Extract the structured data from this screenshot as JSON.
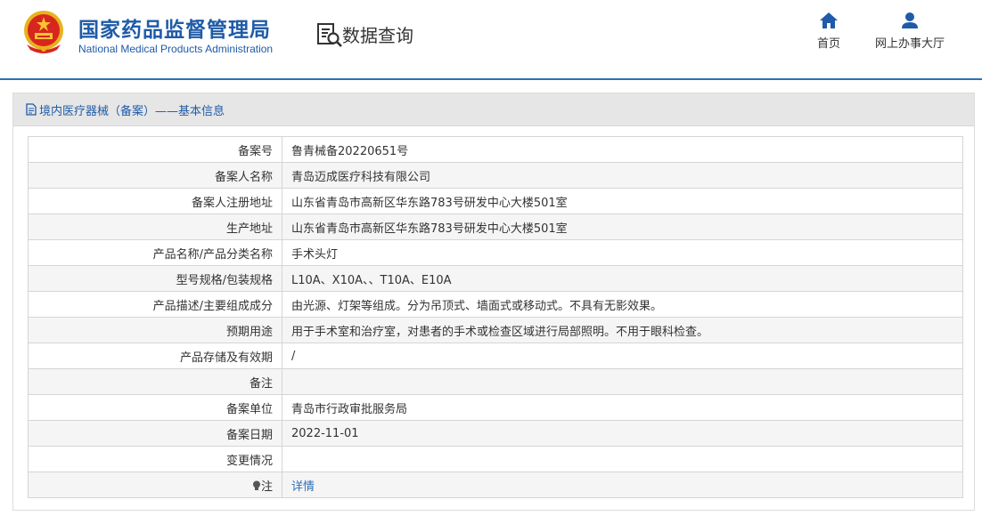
{
  "header": {
    "org_name_cn": "国家药品监督管理局",
    "org_name_en": "National Medical Products Administration",
    "query_title": "数据查询",
    "nav": {
      "home": "首页",
      "online_hall": "网上办事大厅"
    },
    "icons": {
      "emblem": "national-emblem-icon",
      "query": "document-search-icon",
      "home": "home-icon",
      "user": "user-icon"
    }
  },
  "panel": {
    "title": "境内医疗器械（备案）——基本信息",
    "rows": [
      {
        "label": "备案号",
        "value": "鲁青械备20220651号"
      },
      {
        "label": "备案人名称",
        "value": "青岛迈成医疗科技有限公司"
      },
      {
        "label": "备案人注册地址",
        "value": "山东省青岛市高新区华东路783号研发中心大楼501室"
      },
      {
        "label": "生产地址",
        "value": "山东省青岛市高新区华东路783号研发中心大楼501室"
      },
      {
        "label": "产品名称/产品分类名称",
        "value": "手术头灯"
      },
      {
        "label": "型号规格/包装规格",
        "value": "L10A、X10A、、T10A、E10A"
      },
      {
        "label": "产品描述/主要组成成分",
        "value": "由光源、灯架等组成。分为吊顶式、墙面式或移动式。不具有无影效果。"
      },
      {
        "label": "预期用途",
        "value": "用于手术室和治疗室，对患者的手术或检查区域进行局部照明。不用于眼科检查。"
      },
      {
        "label": "产品存储及有效期",
        "value": "/"
      },
      {
        "label": "备注",
        "value": ""
      },
      {
        "label": "备案单位",
        "value": "青岛市行政审批服务局"
      },
      {
        "label": "备案日期",
        "value": "2022-11-01"
      },
      {
        "label": "变更情况",
        "value": ""
      }
    ],
    "note_row": {
      "label": "注",
      "link": "详情"
    }
  },
  "colors": {
    "brand_blue": "#1f5ba8",
    "link_blue": "#2f6fb5"
  }
}
